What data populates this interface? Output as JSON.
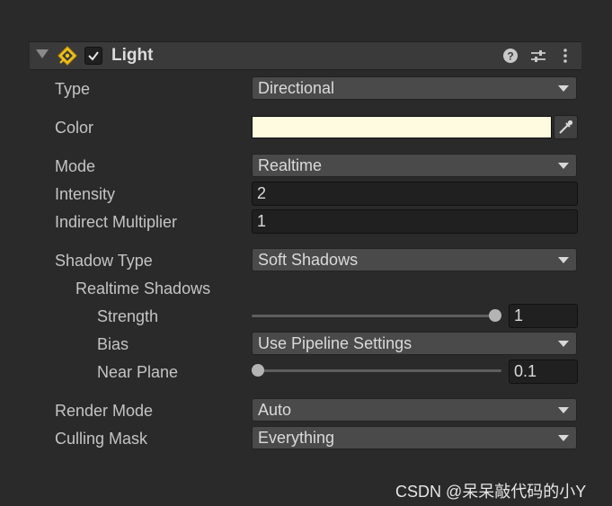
{
  "header": {
    "title": "Light",
    "enabled": true,
    "icons": [
      "foldout-arrow-icon",
      "light-component-icon",
      "checkbox-icon",
      "help-icon",
      "preset-sliders-icon",
      "kebab-menu-icon"
    ]
  },
  "properties": {
    "type": {
      "label": "Type",
      "value": "Directional"
    },
    "color": {
      "label": "Color",
      "value": "#fffbe0"
    },
    "mode": {
      "label": "Mode",
      "value": "Realtime"
    },
    "intensity": {
      "label": "Intensity",
      "value": "2"
    },
    "indirect_multiplier": {
      "label": "Indirect Multiplier",
      "value": "1"
    },
    "shadow_type": {
      "label": "Shadow Type",
      "value": "Soft Shadows"
    },
    "realtime_shadows": {
      "label": "Realtime Shadows"
    },
    "strength": {
      "label": "Strength",
      "value": "1",
      "slider_fraction": 1.0
    },
    "bias": {
      "label": "Bias",
      "value": "Use Pipeline Settings"
    },
    "near_plane": {
      "label": "Near Plane",
      "value": "0.1",
      "slider_fraction": 0.0
    },
    "render_mode": {
      "label": "Render Mode",
      "value": "Auto"
    },
    "culling_mask": {
      "label": "Culling Mask",
      "value": "Everything"
    }
  },
  "watermark": "CSDN @呆呆敲代码的小Y"
}
